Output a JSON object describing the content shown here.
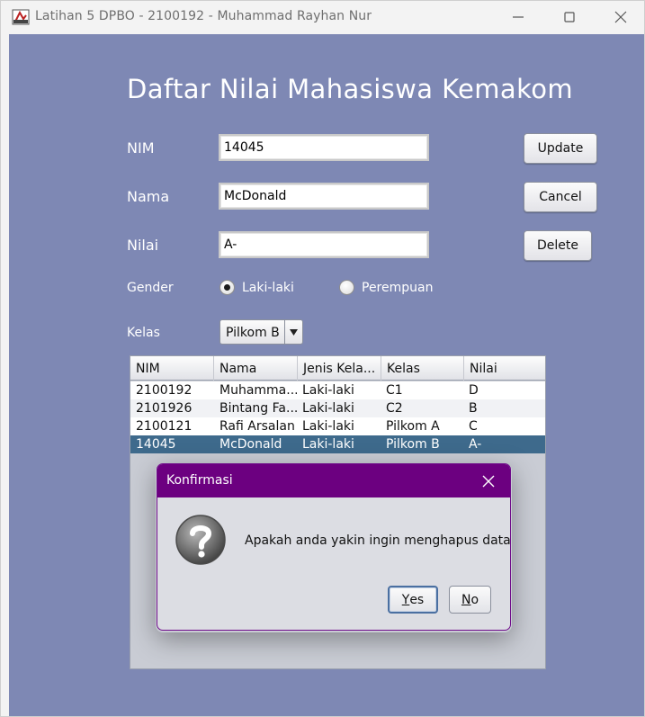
{
  "window": {
    "title": "Latihan 5 DPBO - 2100192 - Muhammad Rayhan Nur",
    "minimize_icon": "minimize-icon",
    "maximize_icon": "maximize-icon",
    "close_icon": "close-icon"
  },
  "form": {
    "heading": "Daftar Nilai Mahasiswa Kemakom",
    "nim_label": "NIM",
    "nim_value": "14045",
    "nama_label": "Nama",
    "nama_value": "McDonald",
    "nilai_label": "Nilai",
    "nilai_value": "A-",
    "gender_label": "Gender",
    "gender_options": [
      {
        "label": "Laki-laki",
        "selected": true
      },
      {
        "label": "Perempuan",
        "selected": false
      }
    ],
    "kelas_label": "Kelas",
    "kelas_value": "Pilkom B"
  },
  "buttons": {
    "update": "Update",
    "cancel": "Cancel",
    "delete": "Delete"
  },
  "table": {
    "columns": [
      "NIM",
      "Nama",
      "Jenis Kela...",
      "Kelas",
      "Nilai"
    ],
    "rows": [
      [
        "2100192",
        "Muhamma...",
        "Laki-laki",
        "C1",
        "D"
      ],
      [
        "2101926",
        "Bintang Fa...",
        "Laki-laki",
        "C2",
        "B"
      ],
      [
        "2100121",
        "Rafi Arsalan",
        "Laki-laki",
        "Pilkom A",
        "C"
      ],
      [
        "14045",
        "McDonald",
        "Laki-laki",
        "Pilkom B",
        "A-"
      ]
    ],
    "selected_row": 3
  },
  "dialog": {
    "title": "Konfirmasi",
    "message": "Apakah anda yakin ingin menghapus data?",
    "yes_mnemonic": "Y",
    "yes_rest": "es",
    "no_mnemonic": "N",
    "no_rest": "o"
  },
  "colors": {
    "background": "#7e88b4",
    "dialog_title": "#6c0080",
    "selected_row": "#3e6a8c"
  }
}
